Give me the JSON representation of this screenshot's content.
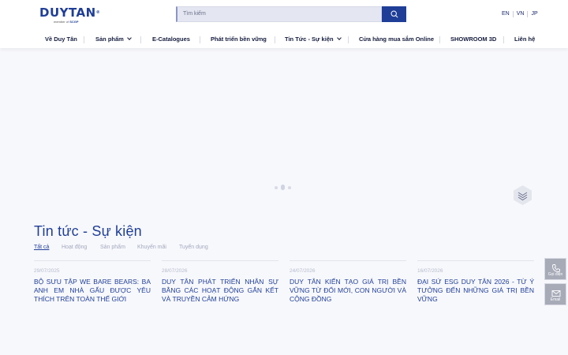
{
  "brand": {
    "name": "DUYTAN",
    "reg": "®",
    "member_prefix": "member of",
    "member_of": "SCGP",
    "primary_color": "#1f3e97"
  },
  "search": {
    "placeholder": "Tìm kiếm",
    "button_icon": "search-icon"
  },
  "languages": [
    "EN",
    "VN",
    "JP"
  ],
  "nav": {
    "items": [
      {
        "label": "Về Duy Tân",
        "dropdown": false
      },
      {
        "label": "Sản phẩm",
        "dropdown": true
      },
      {
        "label": "E-Catalogues",
        "dropdown": false
      },
      {
        "label": "Phát triển bền vững",
        "dropdown": false
      },
      {
        "label": "Tin Tức - Sự kiện",
        "dropdown": true
      },
      {
        "label": "Cửa hàng mua sắm Online",
        "dropdown": false
      },
      {
        "label": "SHOWROOM 3D",
        "dropdown": false
      },
      {
        "label": "Liên hệ",
        "dropdown": false
      }
    ]
  },
  "news": {
    "title": "Tin tức - Sự kiện",
    "tabs": [
      {
        "label": "Tất cả",
        "active": true
      },
      {
        "label": "Hoạt động",
        "active": false
      },
      {
        "label": "Sản phẩm",
        "active": false
      },
      {
        "label": "Khuyến mãi",
        "active": false
      },
      {
        "label": "Tuyển dụng",
        "active": false
      }
    ],
    "articles": [
      {
        "date": "29/07/2025",
        "title": "BỘ SƯU TẬP WE BARE BEARS: BA ANH EM NHÀ GẤU ĐƯỢC YÊU THÍCH TRÊN TOÀN THẾ GIỚI"
      },
      {
        "date": "28/07/2026",
        "title": "DUY TÂN PHÁT TRIỂN NHÂN SỰ BẰNG CÁC HOẠT ĐỘNG GẮN KẾT VÀ TRUYỀN CẢM HỨNG"
      },
      {
        "date": "24/07/2026",
        "title": "DUY TÂN KIẾN TẠO GIÁ TRỊ BỀN VỮNG TỪ ĐỔI MỚI, CON NGƯỜI VÀ CỘNG ĐỒNG"
      },
      {
        "date": "16/07/2026",
        "title": "ĐẠI SỨ ESG DUY TÂN 2026 - TỪ Ý TƯỞNG ĐẾN NHỮNG GIÁ TRỊ BỀN VỮNG"
      }
    ]
  },
  "floating": {
    "call_label": "Gọi điện",
    "email_label": "Email",
    "call_icon": "phone-icon",
    "email_icon": "mail-icon"
  }
}
